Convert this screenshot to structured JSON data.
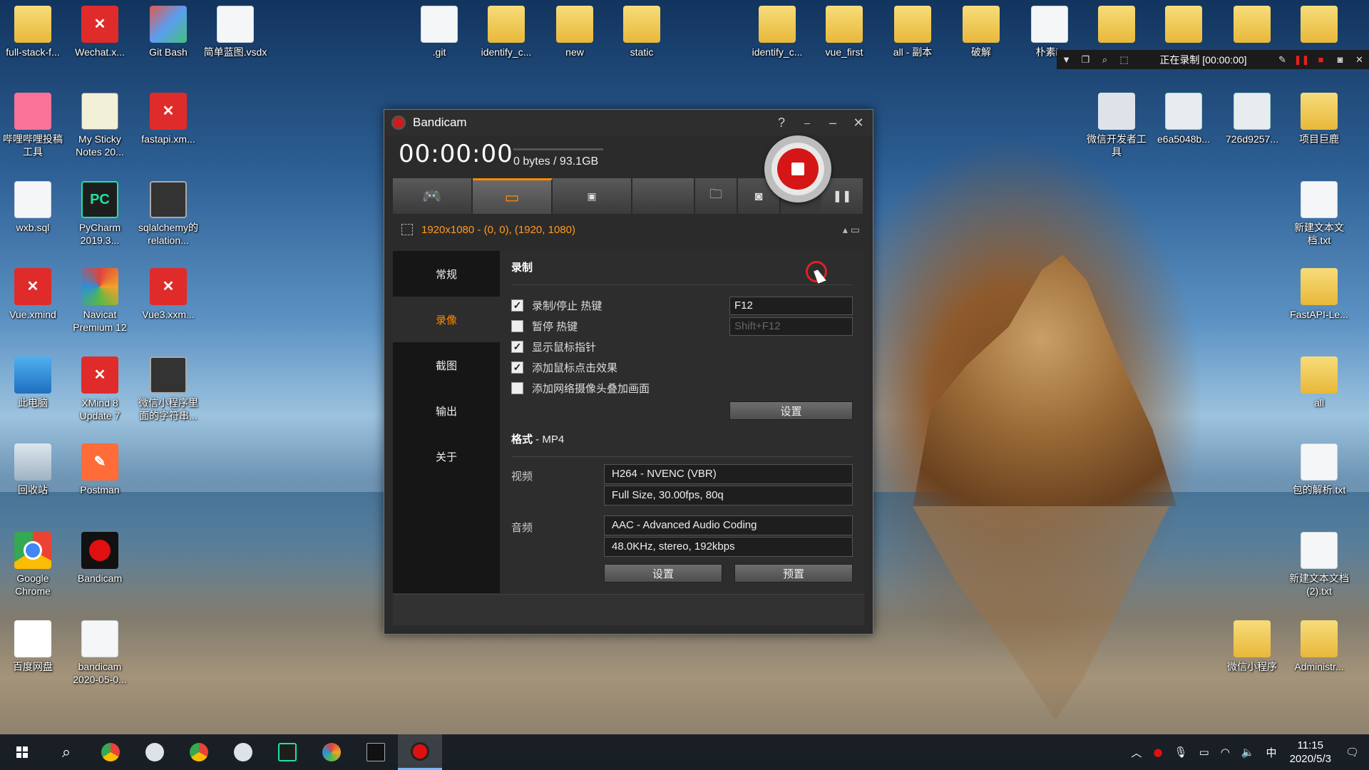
{
  "desktop": {
    "left_icons": [
      {
        "label": "full-stack-f...",
        "type": "folder"
      },
      {
        "label": "Wechat.x...",
        "type": "xmind"
      },
      {
        "label": "Git Bash",
        "type": "gitb"
      },
      {
        "label": "简单蓝图.vsdx",
        "type": "doc"
      },
      {
        "label": "哔哩哔哩投稿工具",
        "type": "bili"
      },
      {
        "label": "My Sticky Notes 20...",
        "type": "sticky"
      },
      {
        "label": "fastapi.xm...",
        "type": "xmind"
      },
      {
        "label": "wxb.sql",
        "type": "doc"
      },
      {
        "label": "PyCharm 2019.3...",
        "type": "pc"
      },
      {
        "label": "sqlalchemy的relation...",
        "type": "video"
      },
      {
        "label": "Vue.xmind",
        "type": "xmind"
      },
      {
        "label": "Navicat Premium 12",
        "type": "navicat"
      },
      {
        "label": "Vue3.xxm...",
        "type": "xmind"
      },
      {
        "label": "此电脑",
        "type": "pc-mon"
      },
      {
        "label": "XMind 8 Update 7",
        "type": "xmind"
      },
      {
        "label": "微信小程序里面的字符串...",
        "type": "video"
      },
      {
        "label": "回收站",
        "type": "recycle"
      },
      {
        "label": "Postman",
        "type": "postman"
      },
      {
        "label": "Google Chrome",
        "type": "chrome"
      },
      {
        "label": "Bandicam",
        "type": "record"
      },
      {
        "label": "百度网盘",
        "type": "baidu"
      },
      {
        "label": "bandicam 2020-05-0...",
        "type": "doc"
      }
    ],
    "top_icons": [
      {
        "label": ".git",
        "type": "doc"
      },
      {
        "label": "identify_c...",
        "type": "folder"
      },
      {
        "label": "new",
        "type": "folder"
      },
      {
        "label": "static",
        "type": "folder"
      },
      {
        "label": "identify_c...",
        "type": "folder"
      },
      {
        "label": "vue_first",
        "type": "folder"
      },
      {
        "label": "all - 副本",
        "type": "folder"
      },
      {
        "label": "破解",
        "type": "folder"
      },
      {
        "label": "朴素ip",
        "type": "doc"
      },
      {
        "label": "",
        "type": "folder"
      },
      {
        "label": "",
        "type": "folder"
      },
      {
        "label": "",
        "type": "folder"
      },
      {
        "label": "",
        "type": "folder"
      }
    ],
    "right_icons": [
      {
        "label": "微信开发者工具",
        "type": "wechat"
      },
      {
        "label": "e6a5048b...",
        "type": "cert"
      },
      {
        "label": "726d9257...",
        "type": "cert"
      },
      {
        "label": "项目巨鹿",
        "type": "folder"
      },
      {
        "label": "新建文本文档.txt",
        "type": "doc"
      },
      {
        "label": "FastAPI-Le...",
        "type": "folder"
      },
      {
        "label": "all",
        "type": "folder"
      },
      {
        "label": "包的解析.txt",
        "type": "doc"
      },
      {
        "label": "新建文本文档 (2).txt",
        "type": "doc"
      },
      {
        "label": "微信小程序",
        "type": "folder"
      },
      {
        "label": "Administr...",
        "type": "folder"
      }
    ]
  },
  "minibar": {
    "status": "正在录制 [00:00:00]"
  },
  "bandicam": {
    "title": "Bandicam",
    "help": "?",
    "elapsed": "00:00:00",
    "size": "0 bytes / 93.1GB",
    "region": "1920x1080 - (0, 0), (1920, 1080)",
    "sidebar": [
      "常规",
      "录像",
      "截图",
      "输出",
      "关于"
    ],
    "active_sidebar": "录像",
    "record_section": {
      "title": "录制",
      "options": [
        {
          "label": "录制/停止 热键",
          "checked": true,
          "hotkey": "F12"
        },
        {
          "label": "暂停 热键",
          "checked": false,
          "hotkey": "Shift+F12"
        },
        {
          "label": "显示鼠标指针",
          "checked": true
        },
        {
          "label": "添加鼠标点击效果",
          "checked": true
        },
        {
          "label": "添加网络摄像头叠加画面",
          "checked": false
        }
      ],
      "settings_button": "设置"
    },
    "format_section": {
      "title": "格式",
      "format": " - MP4",
      "video_label": "视频",
      "video_codec": "H264 - NVENC (VBR)",
      "video_detail": "Full Size, 30.00fps, 80q",
      "audio_label": "音频",
      "audio_codec": "AAC - Advanced Audio Coding",
      "audio_detail": "48.0KHz, stereo, 192kbps",
      "settings_button": "设置",
      "preset_button": "预置"
    }
  },
  "taskbar": {
    "ime": "中",
    "time": "11:15",
    "date": "2020/5/3"
  }
}
